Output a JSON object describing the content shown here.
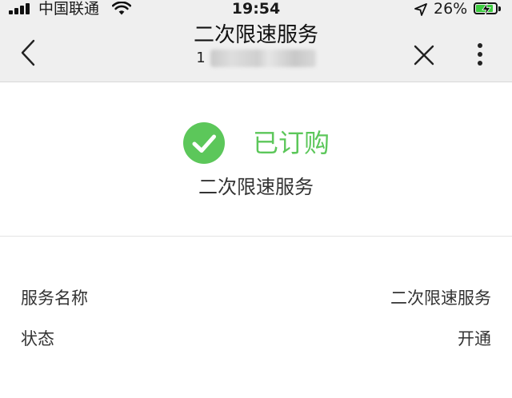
{
  "status_bar": {
    "carrier": "中国联通",
    "time": "19:54",
    "battery_percent": "26%",
    "battery_level": 0.26,
    "battery_color": "#3ccb3f",
    "signal_bars": 4,
    "icons": [
      "signal-icon",
      "wifi-icon",
      "location-arrow-icon",
      "battery-charging-icon"
    ]
  },
  "nav": {
    "title": "二次限速服务",
    "subtitle_visible_digit": "1",
    "back_icon": "chevron-left-icon",
    "close_icon": "close-icon",
    "more_icon": "more-vertical-icon"
  },
  "success": {
    "icon": "check-circle-icon",
    "title": "已订购",
    "service_name": "二次限速服务",
    "accent_color": "#5cc75a"
  },
  "details": [
    {
      "label": "服务名称",
      "value": "二次限速服务"
    },
    {
      "label": "状态",
      "value": "开通"
    }
  ]
}
